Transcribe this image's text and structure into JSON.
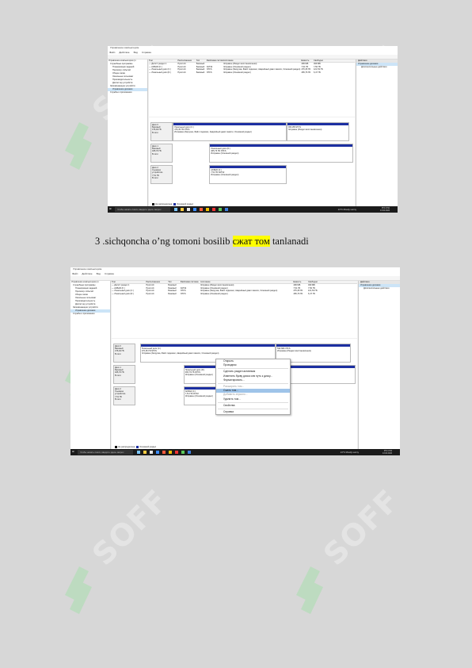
{
  "caption": {
    "before": "3 .sichqoncha o’ng tomoni bosilib ",
    "highlight": "сжат том",
    "after": " tanlanadi"
  },
  "watermark": {
    "text": "SOFF"
  },
  "screenshot": {
    "window_title": "Управление компьютером",
    "menu": [
      "Файл",
      "Действие",
      "Вид",
      "Справка"
    ],
    "tree": [
      "Управление компьютером (л",
      "Служебные программы",
      "Планировщик заданий",
      "Просмотр событий",
      "Общие папки",
      "Локальные пользоват",
      "Производительность",
      "Диспетчер устройств",
      "Запоминающие устройств",
      "Управление дисками",
      "Службы и приложения"
    ],
    "volume_headers": [
      "Том",
      "Расположение",
      "Тип",
      "Файловая система",
      "Состояние",
      "Емкость",
      "Свободно"
    ],
    "volumes": [
      [
        "— Диск 0 раздел 1",
        "Простой",
        "Базовый",
        "",
        "Исправен (Раздел восстановления)",
        "499 МБ",
        "499 МБ"
      ],
      [
        "— AKBAR (F:)",
        "Простой",
        "Базовый",
        "FAT32",
        "Исправен (Основной раздел)",
        "7,51 ГБ",
        "7,50 ГБ"
      ],
      [
        "— Локальный диск (C:)",
        "Простой",
        "Базовый",
        "NTFS",
        "Исправен (Загрузка, Файл подкачки, Аварийный дамп памяти, Основной раздел)",
        "476,35 ГБ",
        "121,53 ГБ"
      ],
      [
        "— Локальный диск (D:)",
        "Простой",
        "Базовый",
        "NTFS",
        "Исправен (Основной раздел)",
        "465,76 ГБ",
        "6,47 ГБ"
      ]
    ],
    "actions": {
      "header": "Действия",
      "selected": "Управление дисками",
      "item": "Дополнительные действия"
    },
    "disks": [
      {
        "label": [
          "Диск 0",
          "Базовый",
          "476,94 ГБ",
          "В сети"
        ],
        "parts": [
          {
            "lines": [
              "1 МБ",
              "Не распределена"
            ],
            "black": true
          },
          {
            "lines": [
              "Локальный диск (C:)",
              "476,35 ГБ NTFS",
              "Исправен (Загрузка, Файл подкачки, Аварийный дамп памяти, Основной раздел)"
            ]
          },
          {
            "lines": [
              "",
              "599 МБ NTFS",
              "Исправен (Раздел восстановления)"
            ]
          }
        ]
      },
      {
        "label": [
          "Диск 1",
          "Базовый",
          "465,76 ГБ",
          "В сети"
        ],
        "parts": [
          {
            "lines": [
              "Локальный диск (D:)",
              "465,76 ГБ NTFS",
              "Исправен (Основной раздел)"
            ]
          }
        ]
      },
      {
        "label": [
          "Диск 2",
          "Съемное устройство",
          "7,51 ГБ",
          "В сети"
        ],
        "parts": [
          {
            "lines": [
              "AKBAR (F:)",
              "7,51 ГБ FAT32",
              "Исправен (Основной раздел)"
            ]
          }
        ]
      }
    ],
    "legend": [
      "Не распределена",
      "Основной раздел"
    ],
    "taskbar": {
      "search": "Чтобы начать поиск, введите здесь запрос",
      "weather": "13°C Mostly sunny",
      "lang": "РУС",
      "time": "8:52",
      "date": "13.04.2024"
    },
    "context_menu": [
      {
        "label": "Открыть",
        "state": "normal"
      },
      {
        "label": "Проводник",
        "state": "normal"
      },
      {
        "sep": true
      },
      {
        "label": "Сделать раздел активным",
        "state": "normal"
      },
      {
        "label": "Изменить букву диска или путь к диску...",
        "state": "normal"
      },
      {
        "label": "Форматировать...",
        "state": "normal"
      },
      {
        "sep": true
      },
      {
        "label": "Расширить том...",
        "state": "disabled"
      },
      {
        "label": "Сжать том...",
        "state": "highlight"
      },
      {
        "label": "Добавить зеркало...",
        "state": "disabled"
      },
      {
        "label": "Удалить том...",
        "state": "normal"
      },
      {
        "sep": true
      },
      {
        "label": "Свойства",
        "state": "normal"
      },
      {
        "sep": true
      },
      {
        "label": "Справка",
        "state": "normal"
      }
    ]
  }
}
